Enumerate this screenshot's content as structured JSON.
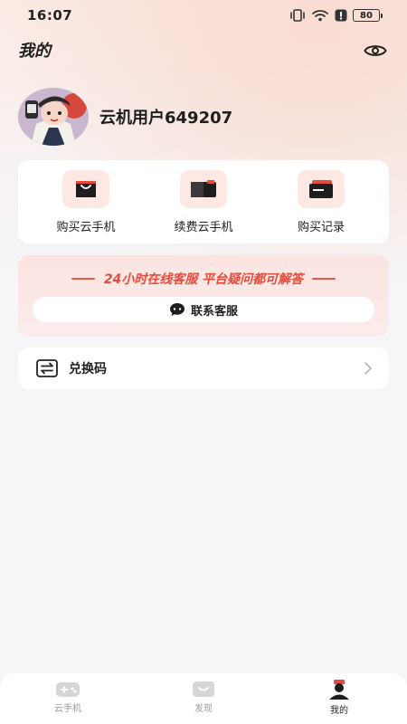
{
  "status_bar": {
    "time": "16:07",
    "battery": "80"
  },
  "header": {
    "title": "我的"
  },
  "profile": {
    "username": "云机用户649207"
  },
  "quick_actions": [
    {
      "label": "购买云手机",
      "icon": "shopping-bag-icon"
    },
    {
      "label": "续费云手机",
      "icon": "renew-phone-icon"
    },
    {
      "label": "购买记录",
      "icon": "wallet-record-icon"
    }
  ],
  "service": {
    "banner": "24小时在线客服 平台疑问都可解答",
    "contact_label": "联系客服"
  },
  "redeem": {
    "label": "兑换码"
  },
  "tabs": [
    {
      "label": "云手机",
      "icon": "gamepad-icon",
      "active": false
    },
    {
      "label": "发现",
      "icon": "discover-icon",
      "active": false
    },
    {
      "label": "我的",
      "icon": "profile-icon",
      "active": true
    }
  ],
  "colors": {
    "accent": "#e64b3c",
    "icon_bg": "#fde8e4"
  }
}
